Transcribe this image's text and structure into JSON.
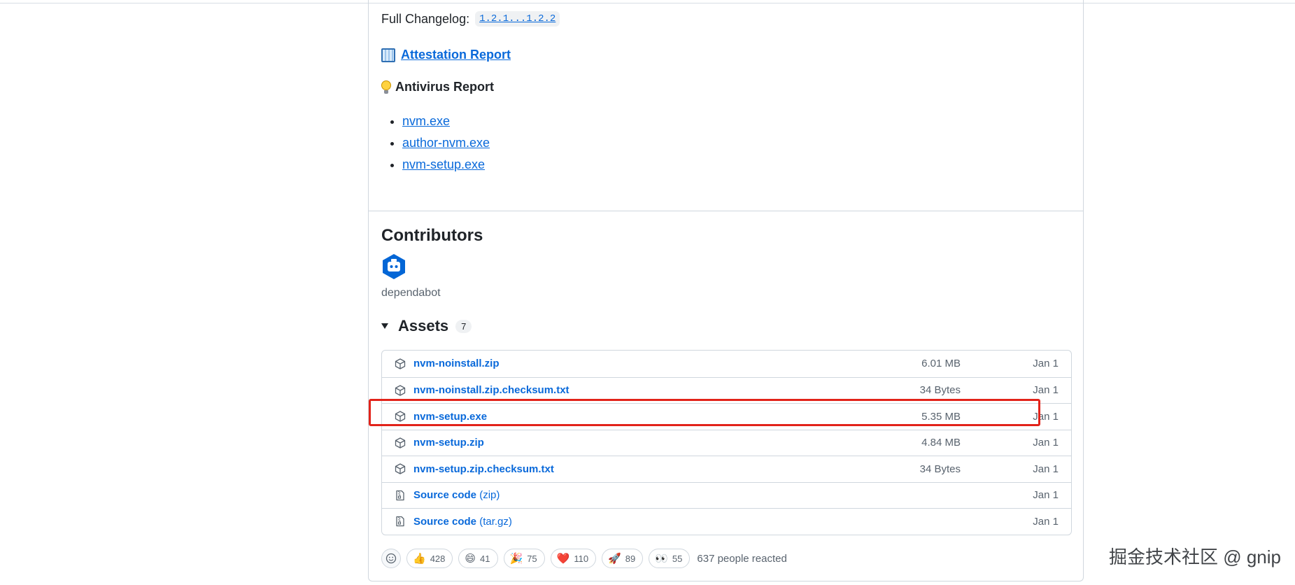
{
  "release": {
    "changelog_label": "Full Changelog:",
    "changelog_link": "1.2.1...1.2.2",
    "attestation_link": "Attestation Report",
    "antivirus_heading": "Antivirus Report",
    "antivirus_items": [
      "nvm.exe",
      "author-nvm.exe",
      "nvm-setup.exe"
    ]
  },
  "contributors": {
    "title": "Contributors",
    "names": [
      "dependabot"
    ]
  },
  "assets": {
    "title": "Assets",
    "count": "7",
    "rows": [
      {
        "name": "nvm-noinstall.zip",
        "suffix": "",
        "size": "6.01 MB",
        "date": "Jan 1",
        "icon": "package-icon"
      },
      {
        "name": "nvm-noinstall.zip.checksum.txt",
        "suffix": "",
        "size": "34 Bytes",
        "date": "Jan 1",
        "icon": "package-icon"
      },
      {
        "name": "nvm-setup.exe",
        "suffix": "",
        "size": "5.35 MB",
        "date": "Jan 1",
        "icon": "package-icon"
      },
      {
        "name": "nvm-setup.zip",
        "suffix": "",
        "size": "4.84 MB",
        "date": "Jan 1",
        "icon": "package-icon"
      },
      {
        "name": "nvm-setup.zip.checksum.txt",
        "suffix": "",
        "size": "34 Bytes",
        "date": "Jan 1",
        "icon": "package-icon"
      },
      {
        "name": "Source code",
        "suffix": "(zip)",
        "size": "",
        "date": "Jan 1",
        "icon": "file-zip-icon"
      },
      {
        "name": "Source code",
        "suffix": "(tar.gz)",
        "size": "",
        "date": "Jan 1",
        "icon": "file-zip-icon"
      }
    ]
  },
  "reactions": {
    "items": [
      {
        "emoji": "👍",
        "count": "428",
        "icon": "thumbs-up-icon"
      },
      {
        "emoji": "😄",
        "count": "41",
        "icon": "laugh-icon"
      },
      {
        "emoji": "🎉",
        "count": "75",
        "icon": "hooray-icon"
      },
      {
        "emoji": "❤️",
        "count": "110",
        "icon": "heart-icon"
      },
      {
        "emoji": "🚀",
        "count": "89",
        "icon": "rocket-icon"
      },
      {
        "emoji": "👀",
        "count": "55",
        "icon": "eyes-icon"
      }
    ],
    "summary": "637 people reacted"
  },
  "watermark": "掘金技术社区 @ gnip",
  "colors": {
    "link": "#0969da",
    "highlight": "#e2231a",
    "border": "#d0d7de"
  }
}
